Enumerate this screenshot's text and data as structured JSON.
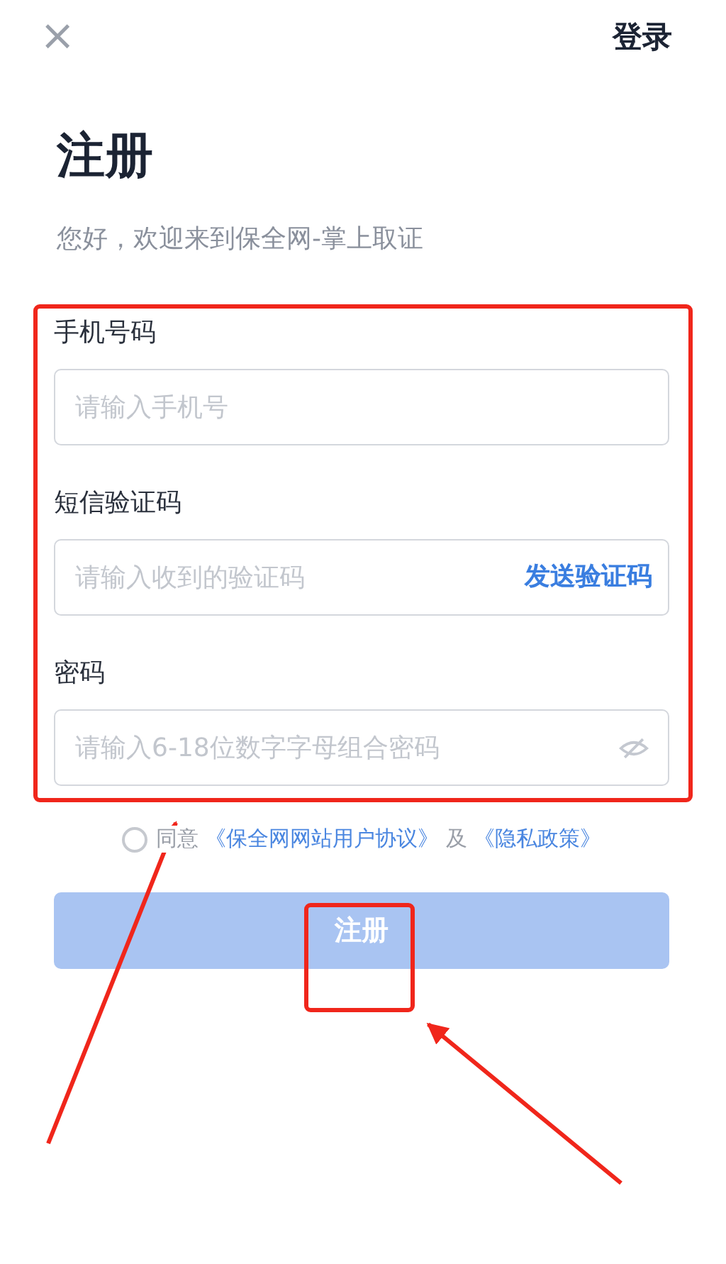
{
  "header": {
    "close": "×",
    "login_link": "登录"
  },
  "title": "注册",
  "subtitle": "您好，欢迎来到保全网-掌上取证",
  "fields": [
    {
      "kind": "text",
      "label": "手机号码",
      "placeholder": "请输入手机号"
    },
    {
      "kind": "code",
      "label": "短信验证码",
      "placeholder": "请输入收到的验证码",
      "action": "发送验证码"
    },
    {
      "kind": "password",
      "label": "密码",
      "placeholder": "请输入6-18位数字字母组合密码",
      "visible": false
    }
  ],
  "agreement": {
    "checked": false,
    "parts": [
      {
        "kind": "text",
        "text": "同意"
      },
      {
        "kind": "link",
        "text": "《保全网网站用户协议》"
      },
      {
        "kind": "text",
        "text": "及"
      },
      {
        "kind": "link",
        "text": "《隐私政策》"
      }
    ]
  },
  "submit": {
    "label": "注册",
    "disabled": true
  }
}
